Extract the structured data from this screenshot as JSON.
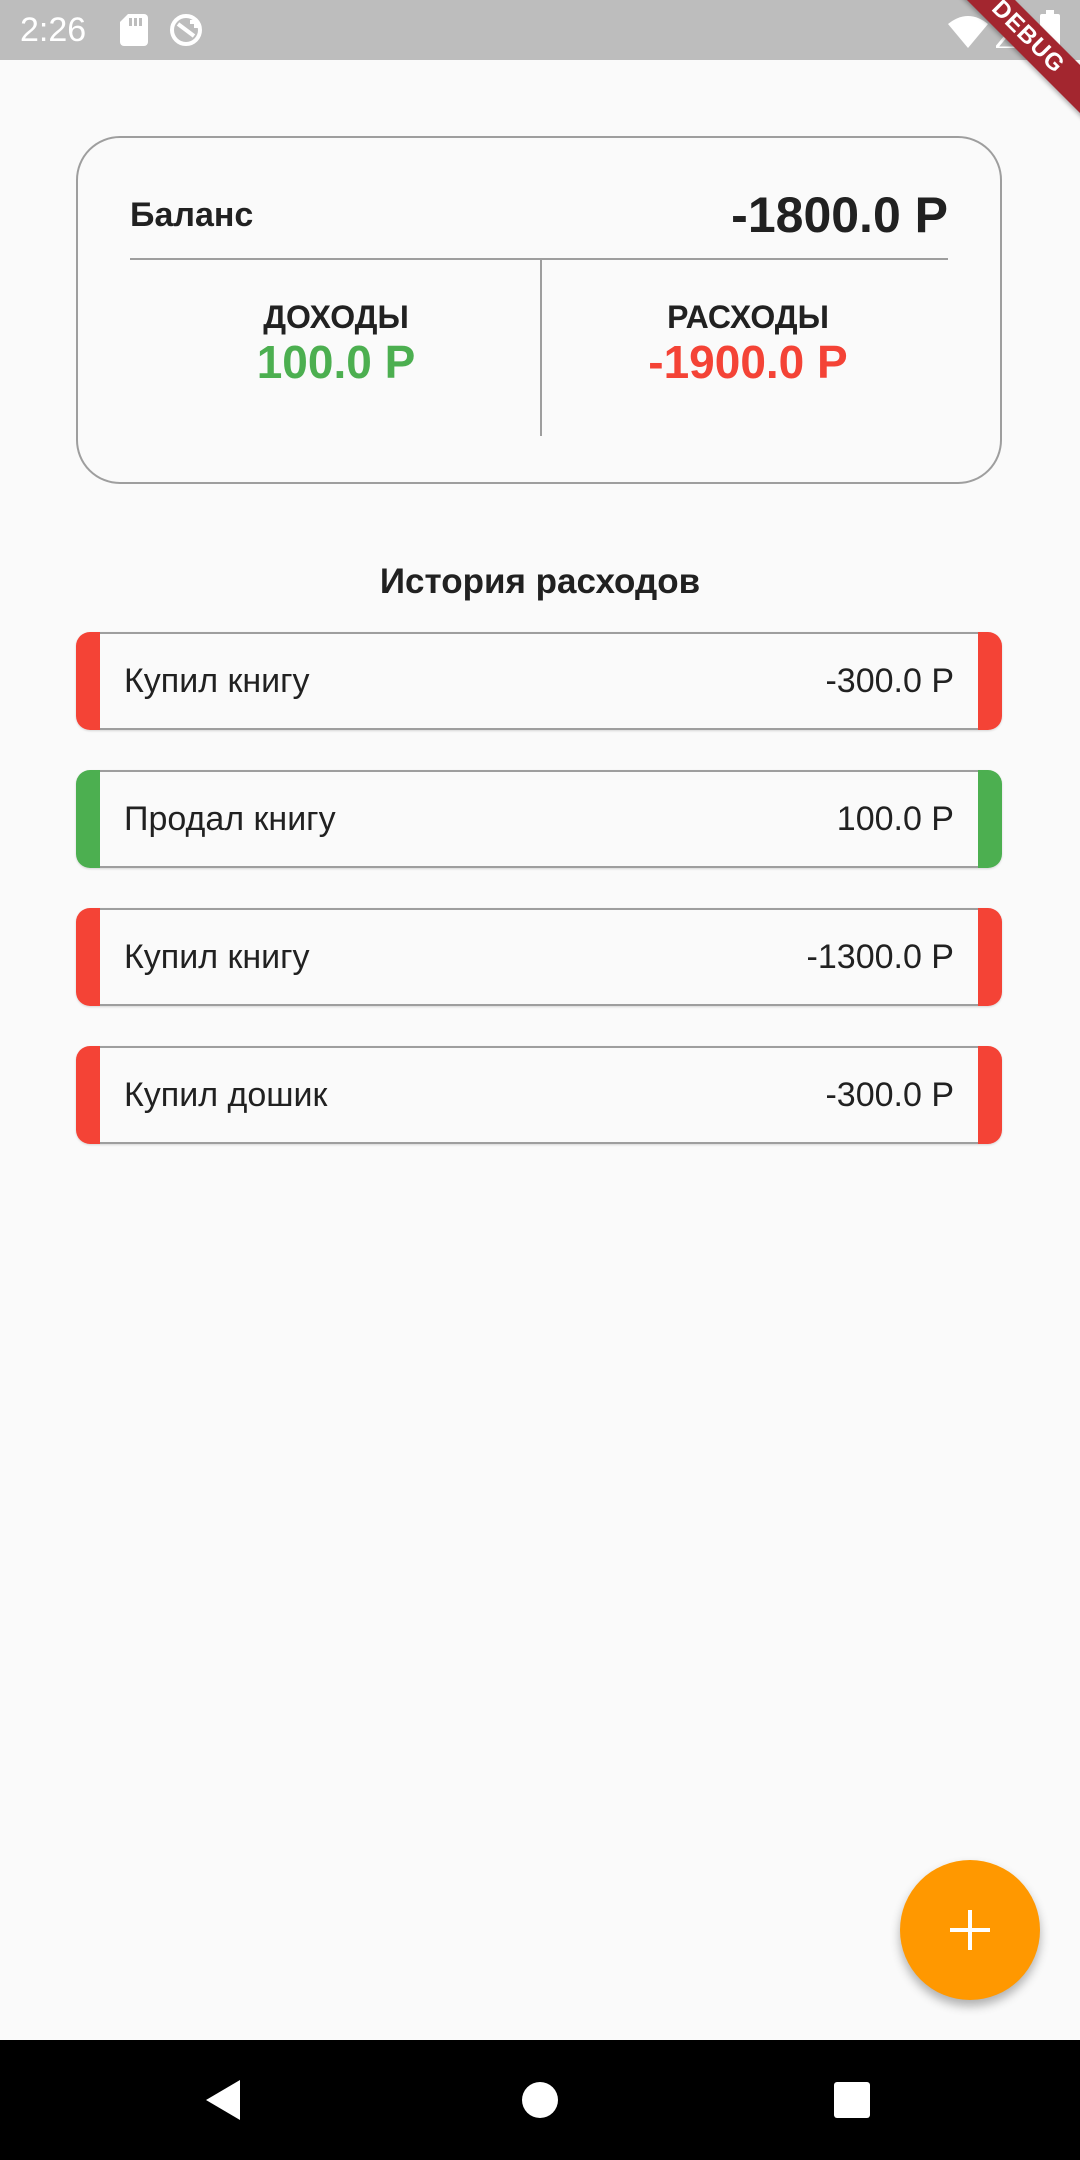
{
  "status_bar": {
    "time": "2:26",
    "debug_label": "DEBUG"
  },
  "summary": {
    "balance_label": "Баланс",
    "balance_value": "-1800.0 Р",
    "income_label": "ДОХОДЫ",
    "income_value": "100.0 Р",
    "expense_label": "РАСХОДЫ",
    "expense_value": "-1900.0 Р"
  },
  "history": {
    "title": "История расходов",
    "items": [
      {
        "name": "Купил книгу",
        "amount": "-300.0 Р",
        "type": "expense"
      },
      {
        "name": "Продал книгу",
        "amount": "100.0 Р",
        "type": "income"
      },
      {
        "name": "Купил книгу",
        "amount": "-1300.0 Р",
        "type": "expense"
      },
      {
        "name": "Купил дошик",
        "amount": "-300.0 Р",
        "type": "expense"
      }
    ]
  },
  "fab": {
    "icon": "plus-icon"
  },
  "colors": {
    "income": "#4caf50",
    "expense": "#f44336",
    "fab": "#ff9800",
    "status_bar": "#bdbdbd"
  },
  "nav_bar": {
    "icons": [
      "back-icon",
      "home-icon",
      "recent-apps-icon"
    ]
  }
}
